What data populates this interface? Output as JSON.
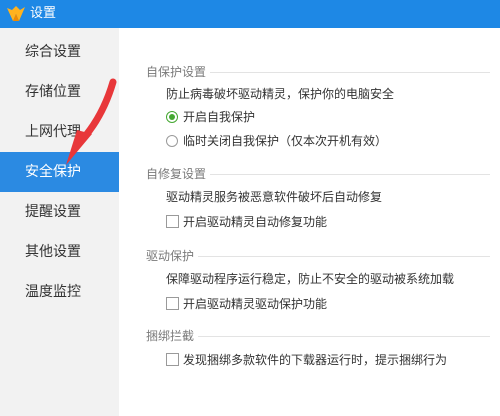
{
  "window": {
    "title": "设置"
  },
  "sidebar": {
    "items": [
      {
        "label": "综合设置"
      },
      {
        "label": "存储位置"
      },
      {
        "label": "上网代理"
      },
      {
        "label": "安全保护",
        "active": true
      },
      {
        "label": "提醒设置"
      },
      {
        "label": "其他设置"
      },
      {
        "label": "温度监控"
      }
    ]
  },
  "sections": {
    "self_protect": {
      "title": "自保护设置",
      "desc": "防止病毒破坏驱动精灵，保护你的电脑安全",
      "options": [
        {
          "label": "开启自我保护",
          "checked": true
        },
        {
          "label": "临时关闭自我保护（仅本次开机有效）",
          "checked": false
        }
      ]
    },
    "self_repair": {
      "title": "自修复设置",
      "desc": "驱动精灵服务被恶意软件破坏后自动修复",
      "option": {
        "label": "开启驱动精灵自动修复功能",
        "checked": false
      }
    },
    "driver_protect": {
      "title": "驱动保护",
      "desc": "保障驱动程序运行稳定，防止不安全的驱动被系统加载",
      "option": {
        "label": "开启驱动精灵驱动保护功能",
        "checked": false
      }
    },
    "bundle_block": {
      "title": "捆绑拦截",
      "option": {
        "label": "发现捆绑多款软件的下载器运行时，提示捆绑行为",
        "checked": false
      }
    }
  },
  "colors": {
    "titlebar": "#1e88e5",
    "sidebar_active": "#2b8ae2",
    "radio_checked": "#45a832",
    "annotation_arrow": "#e8373a"
  }
}
